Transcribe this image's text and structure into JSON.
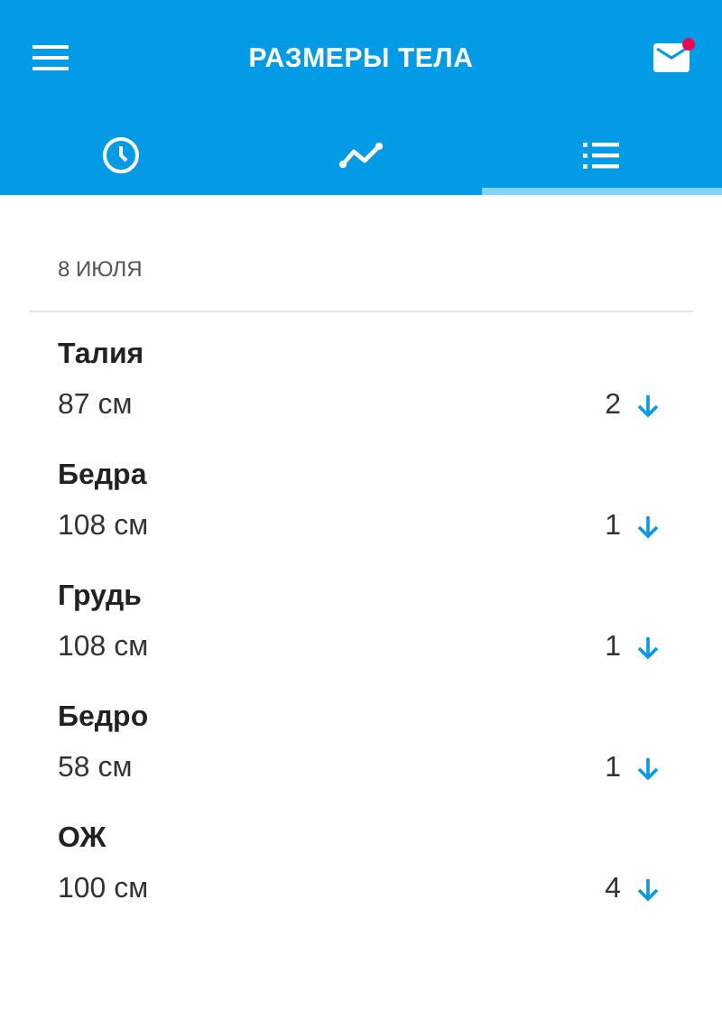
{
  "app_bar": {
    "title": "РАЗМЕРЫ ТЕЛА",
    "mail_unread": true
  },
  "tabs": [
    {
      "kind": "history",
      "selected": false
    },
    {
      "kind": "chart",
      "selected": false
    },
    {
      "kind": "list",
      "selected": true
    }
  ],
  "date": "8 ИЮЛЯ",
  "measurements": [
    {
      "name": "Талия",
      "value": "87 см",
      "count": "2",
      "kind": "down"
    },
    {
      "name": "Бедра",
      "value": "108 см",
      "count": "1",
      "kind": "down"
    },
    {
      "name": "Грудь",
      "value": "108 см",
      "count": "1",
      "kind": "down"
    },
    {
      "name": "Бедро",
      "value": "58 см",
      "count": "1",
      "kind": "down"
    },
    {
      "name": "ОЖ",
      "value": "100 см",
      "count": "4",
      "kind": "down"
    }
  ]
}
